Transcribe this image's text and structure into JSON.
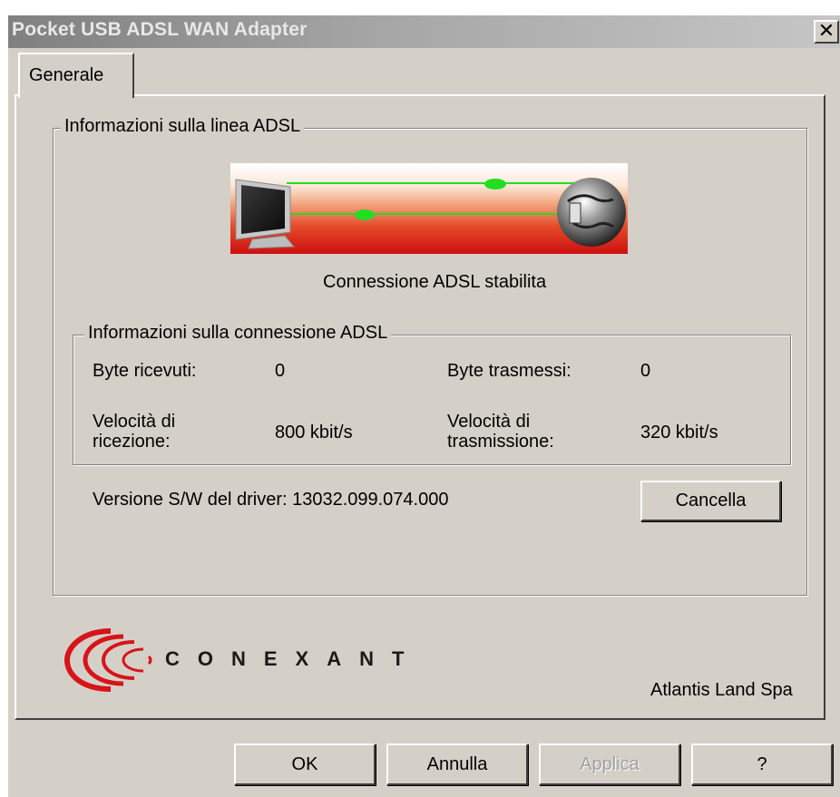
{
  "window": {
    "title": "Pocket USB ADSL WAN Adapter",
    "close_label": "✕"
  },
  "tabs": [
    {
      "label": "Generale"
    }
  ],
  "line_info": {
    "group_title": "Informazioni sulla linea ADSL",
    "status_text": "Connessione ADSL stabilita"
  },
  "connection_info": {
    "group_title": "Informazioni sulla connessione ADSL",
    "bytes_received_label": "Byte ricevuti:",
    "bytes_received_value": "0",
    "bytes_sent_label": "Byte trasmessi:",
    "bytes_sent_value": "0",
    "rx_speed_label": "Velocità di ricezione:",
    "rx_speed_value": "800 kbit/s",
    "tx_speed_label": "Velocità di trasmissione:",
    "tx_speed_value": "320 kbit/s"
  },
  "driver": {
    "version_text": "Versione S/W del driver: 13032.099.074.000",
    "clear_button": "Cancella"
  },
  "branding": {
    "logo_text": "CONEXANT",
    "company": "Atlantis Land Spa"
  },
  "buttons": {
    "ok": "OK",
    "cancel": "Annulla",
    "apply": "Applica",
    "help": "?"
  },
  "colors": {
    "logo_red": "#d8131a",
    "link_green": "#22dd22"
  }
}
